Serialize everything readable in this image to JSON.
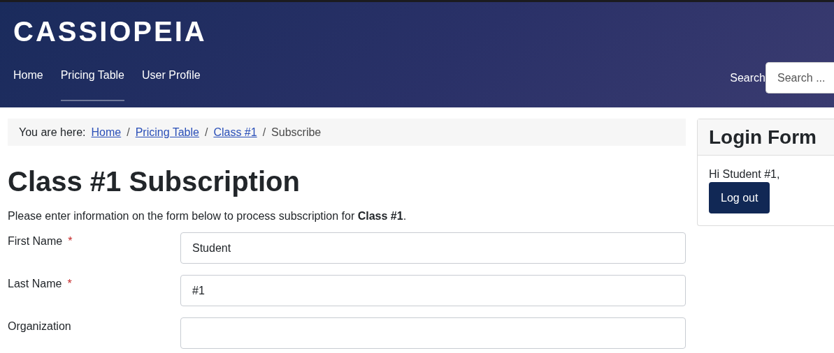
{
  "header": {
    "logo": "CASSIOPEIA",
    "nav": [
      {
        "label": "Home",
        "selected": false
      },
      {
        "label": "Pricing Table",
        "selected": true
      },
      {
        "label": "User Profile",
        "selected": false
      }
    ],
    "search": {
      "label": "Search",
      "placeholder": "Search ..."
    }
  },
  "breadcrumbs": {
    "prefix": "You are here:",
    "separator": "/",
    "items": [
      {
        "label": "Home",
        "kind": "link"
      },
      {
        "label": "Pricing Table",
        "kind": "link"
      },
      {
        "label": "Class #1",
        "kind": "link"
      },
      {
        "label": "Subscribe",
        "kind": "current"
      }
    ]
  },
  "title": "Class #1 Subscription",
  "intro": "Please enter information on the form below to process subscription for **Class #1**.",
  "fields": [
    {
      "label": "First Name",
      "required_mark": "*",
      "value": "Student"
    },
    {
      "label": "Last Name",
      "required_mark": "*",
      "value": "#1"
    },
    {
      "label": "Organization"
    }
  ],
  "login": {
    "title": "Login Form",
    "greeting": "Hi Student #1,",
    "button": "Log out"
  }
}
